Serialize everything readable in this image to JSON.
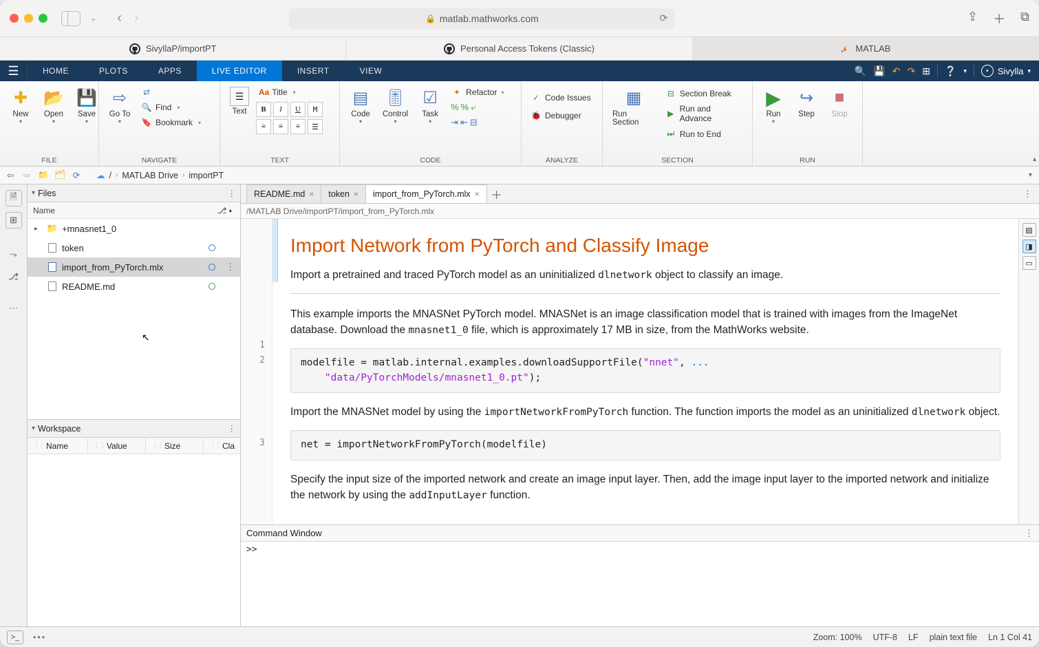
{
  "safari": {
    "url": "matlab.mathworks.com",
    "tabs": [
      {
        "label": "SivyllaP/importPT",
        "icon": "github"
      },
      {
        "label": "Personal Access Tokens (Classic)",
        "icon": "github"
      },
      {
        "label": "MATLAB",
        "icon": "matlab"
      }
    ],
    "active_tab": 2
  },
  "toolstrip": {
    "tabs": [
      "HOME",
      "PLOTS",
      "APPS",
      "LIVE EDITOR",
      "INSERT",
      "VIEW"
    ],
    "active": "LIVE EDITOR",
    "user": "Sivylla"
  },
  "ribbon": {
    "file": {
      "label": "FILE",
      "new": "New",
      "open": "Open",
      "save": "Save"
    },
    "navigate": {
      "label": "NAVIGATE",
      "goto": "Go To",
      "find": "Find",
      "bookmark": "Bookmark"
    },
    "text": {
      "label": "TEXT",
      "text_btn": "Text",
      "title": "Title"
    },
    "code": {
      "label": "CODE",
      "code": "Code",
      "control": "Control",
      "task": "Task",
      "refactor": "Refactor"
    },
    "analyze": {
      "label": "ANALYZE",
      "issues": "Code Issues",
      "debugger": "Debugger"
    },
    "section": {
      "label": "SECTION",
      "run_section": "Run Section",
      "break": "Section Break",
      "advance": "Run and Advance",
      "to_end": "Run to End"
    },
    "run": {
      "label": "RUN",
      "run": "Run",
      "step": "Step",
      "stop": "Stop"
    }
  },
  "path": {
    "root": "MATLAB Drive",
    "folder": "importPT"
  },
  "files_panel": {
    "title": "Files",
    "col_name": "Name",
    "items": [
      {
        "name": "+mnasnet1_0",
        "type": "folder",
        "expandable": true
      },
      {
        "name": "token",
        "type": "file",
        "status": "modified"
      },
      {
        "name": "import_from_PyTorch.mlx",
        "type": "mlx",
        "status": "modified",
        "selected": true
      },
      {
        "name": "README.md",
        "type": "file",
        "status": "new"
      }
    ]
  },
  "workspace_panel": {
    "title": "Workspace",
    "cols": [
      "Name",
      "Value",
      "Size",
      "Cla"
    ]
  },
  "editor": {
    "tabs": [
      {
        "label": "README.md"
      },
      {
        "label": "token"
      },
      {
        "label": "import_from_PyTorch.mlx",
        "active": true
      }
    ],
    "file_path": "/MATLAB Drive/importPT/import_from_PyTorch.mlx",
    "title": "Import Network from PyTorch and Classify Image",
    "p1a": "Import a pretrained and traced PyTorch model as an uninitialized ",
    "p1code": "dlnetwork",
    "p1b": " object to classify an image.",
    "p2a": "This example imports the MNASNet PyTorch model. MNASNet is an image classification model that is trained with images from the ImageNet database. Download the ",
    "p2code": "mnasnet1_0",
    "p2b": " file, which is approximately 17 MB in size, from the MathWorks website.",
    "code1_line1_a": "modelfile = matlab.internal.examples.downloadSupportFile(",
    "code1_line1_str": "\"nnet\"",
    "code1_line1_b": ", ",
    "code1_line1_dots": "...",
    "code1_line2_str": "\"data/PyTorchModels/mnasnet1_0.pt\"",
    "code1_line2_b": ");",
    "p3a": "Import the MNASNet model by using the ",
    "p3code": "importNetworkFromPyTorch",
    "p3b": " function. The function imports the model as an uninitialized ",
    "p3code2": "dlnetwork",
    "p3c": " object.",
    "code2": "net = importNetworkFromPyTorch(modelfile)",
    "p4a": "Specify the input size of the imported network and create an image input layer. Then, add the image input layer to the imported network and initialize the network by using the ",
    "p4code": "addInputLayer",
    "p4b": " function.",
    "line_numbers": [
      "1",
      "2",
      "3"
    ]
  },
  "cmd": {
    "title": "Command Window",
    "prompt": ">>"
  },
  "status": {
    "zoom": "Zoom: 100%",
    "encoding": "UTF-8",
    "eol": "LF",
    "type": "plain text file",
    "pos": "Ln 1  Col 41"
  }
}
